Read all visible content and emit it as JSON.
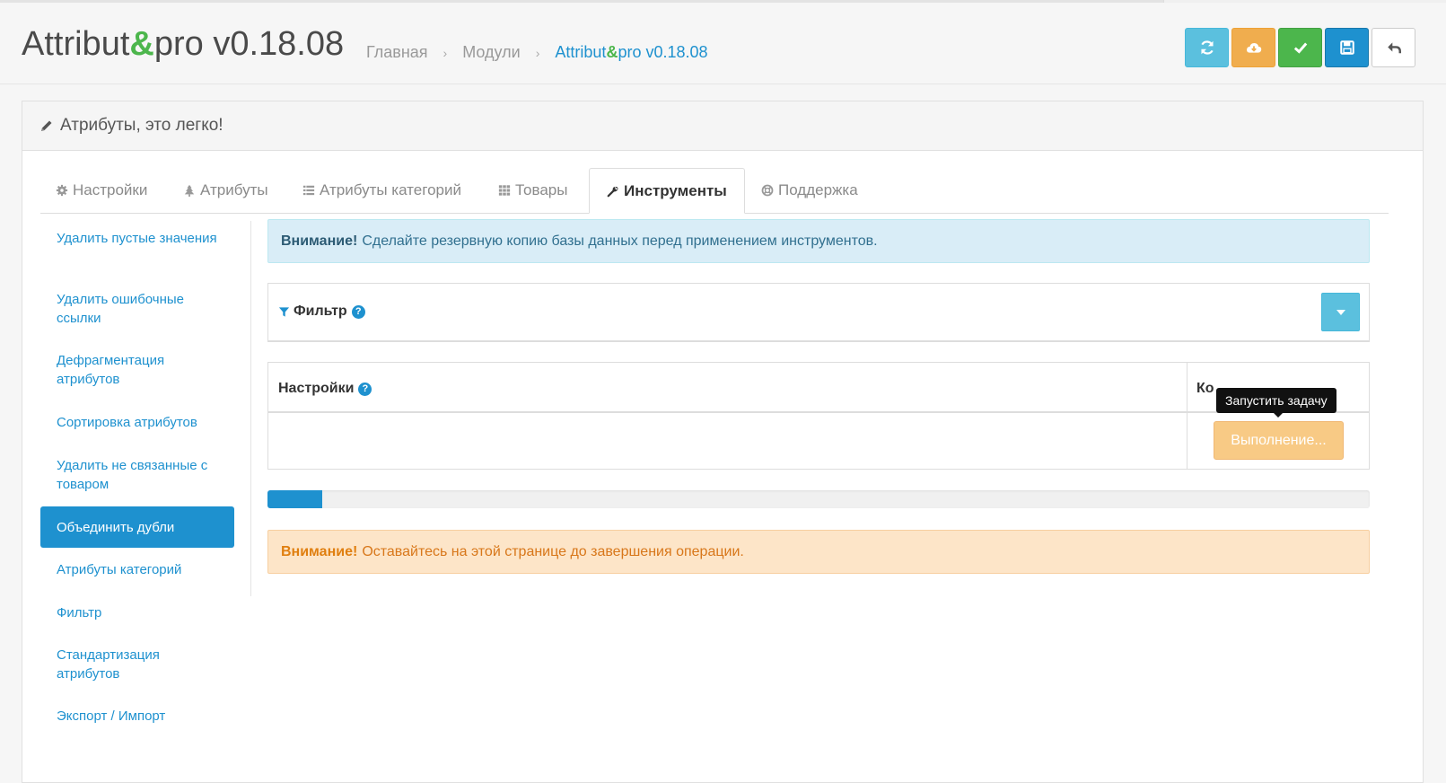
{
  "header": {
    "title_prefix": "Attribut",
    "title_amp": "&",
    "title_suffix": "pro v0.18.08",
    "breadcrumb": {
      "home": "Главная",
      "modules": "Модули",
      "current_prefix": "Attribut",
      "current_amp": "&",
      "current_suffix": "pro v0.18.08",
      "separator": "›"
    }
  },
  "toolbar": {
    "buttons": [
      {
        "name": "refresh-button",
        "icon": "refresh-icon",
        "color": "#5bc0de"
      },
      {
        "name": "download-button",
        "icon": "cloud-download-icon",
        "color": "#f0ad4e"
      },
      {
        "name": "apply-button",
        "icon": "check-icon",
        "color": "#4cb64c"
      },
      {
        "name": "save-button",
        "icon": "save-icon",
        "color": "#1e91cf"
      },
      {
        "name": "back-button",
        "icon": "reply-icon",
        "color": "#ffffff"
      }
    ]
  },
  "panel": {
    "heading": "Атрибуты, это легко!"
  },
  "tabs": [
    {
      "label": "Настройки",
      "icon": "gear-icon"
    },
    {
      "label": "Атрибуты",
      "icon": "tree-icon"
    },
    {
      "label": "Атрибуты категорий",
      "icon": "list-icon"
    },
    {
      "label": "Товары",
      "icon": "grid-icon"
    },
    {
      "label": "Инструменты",
      "icon": "wrench-icon",
      "active": true
    },
    {
      "label": "Поддержка",
      "icon": "lifebuoy-icon"
    }
  ],
  "sidebar": {
    "items": [
      {
        "label": "Удалить пустые значения"
      },
      {
        "label": "Удалить ошибочные ссылки"
      },
      {
        "label": "Дефрагментация атрибутов"
      },
      {
        "label": "Сортировка атрибутов"
      },
      {
        "label": "Удалить не связанные с товаром"
      },
      {
        "label": "Объединить дубли",
        "active": true
      },
      {
        "label": "Атрибуты категорий"
      },
      {
        "label": "Фильтр"
      },
      {
        "label": "Стандартизация атрибутов"
      },
      {
        "label": "Экспорт / Импорт"
      }
    ]
  },
  "main": {
    "alert_info": {
      "strong": "Внимание!",
      "text": "Сделайте резервную копию базы данных перед применением инструментов."
    },
    "filter": {
      "title": "Фильтр",
      "help": "?"
    },
    "table": {
      "col_settings": "Настройки",
      "col_settings_help": "?",
      "col_command": "Ко",
      "run_button": "Выполнение...",
      "tooltip": "Запустить задачу"
    },
    "progress": {
      "percent": 5
    },
    "alert_warning": {
      "strong": "Внимание!",
      "text": "Оставайтесь на этой странице до завершения операции."
    }
  },
  "colors": {
    "accent": "#1e91cf",
    "brand_green": "#4cb64c",
    "info_bg": "#d9edf7",
    "warning_bg": "#fde5c8"
  }
}
